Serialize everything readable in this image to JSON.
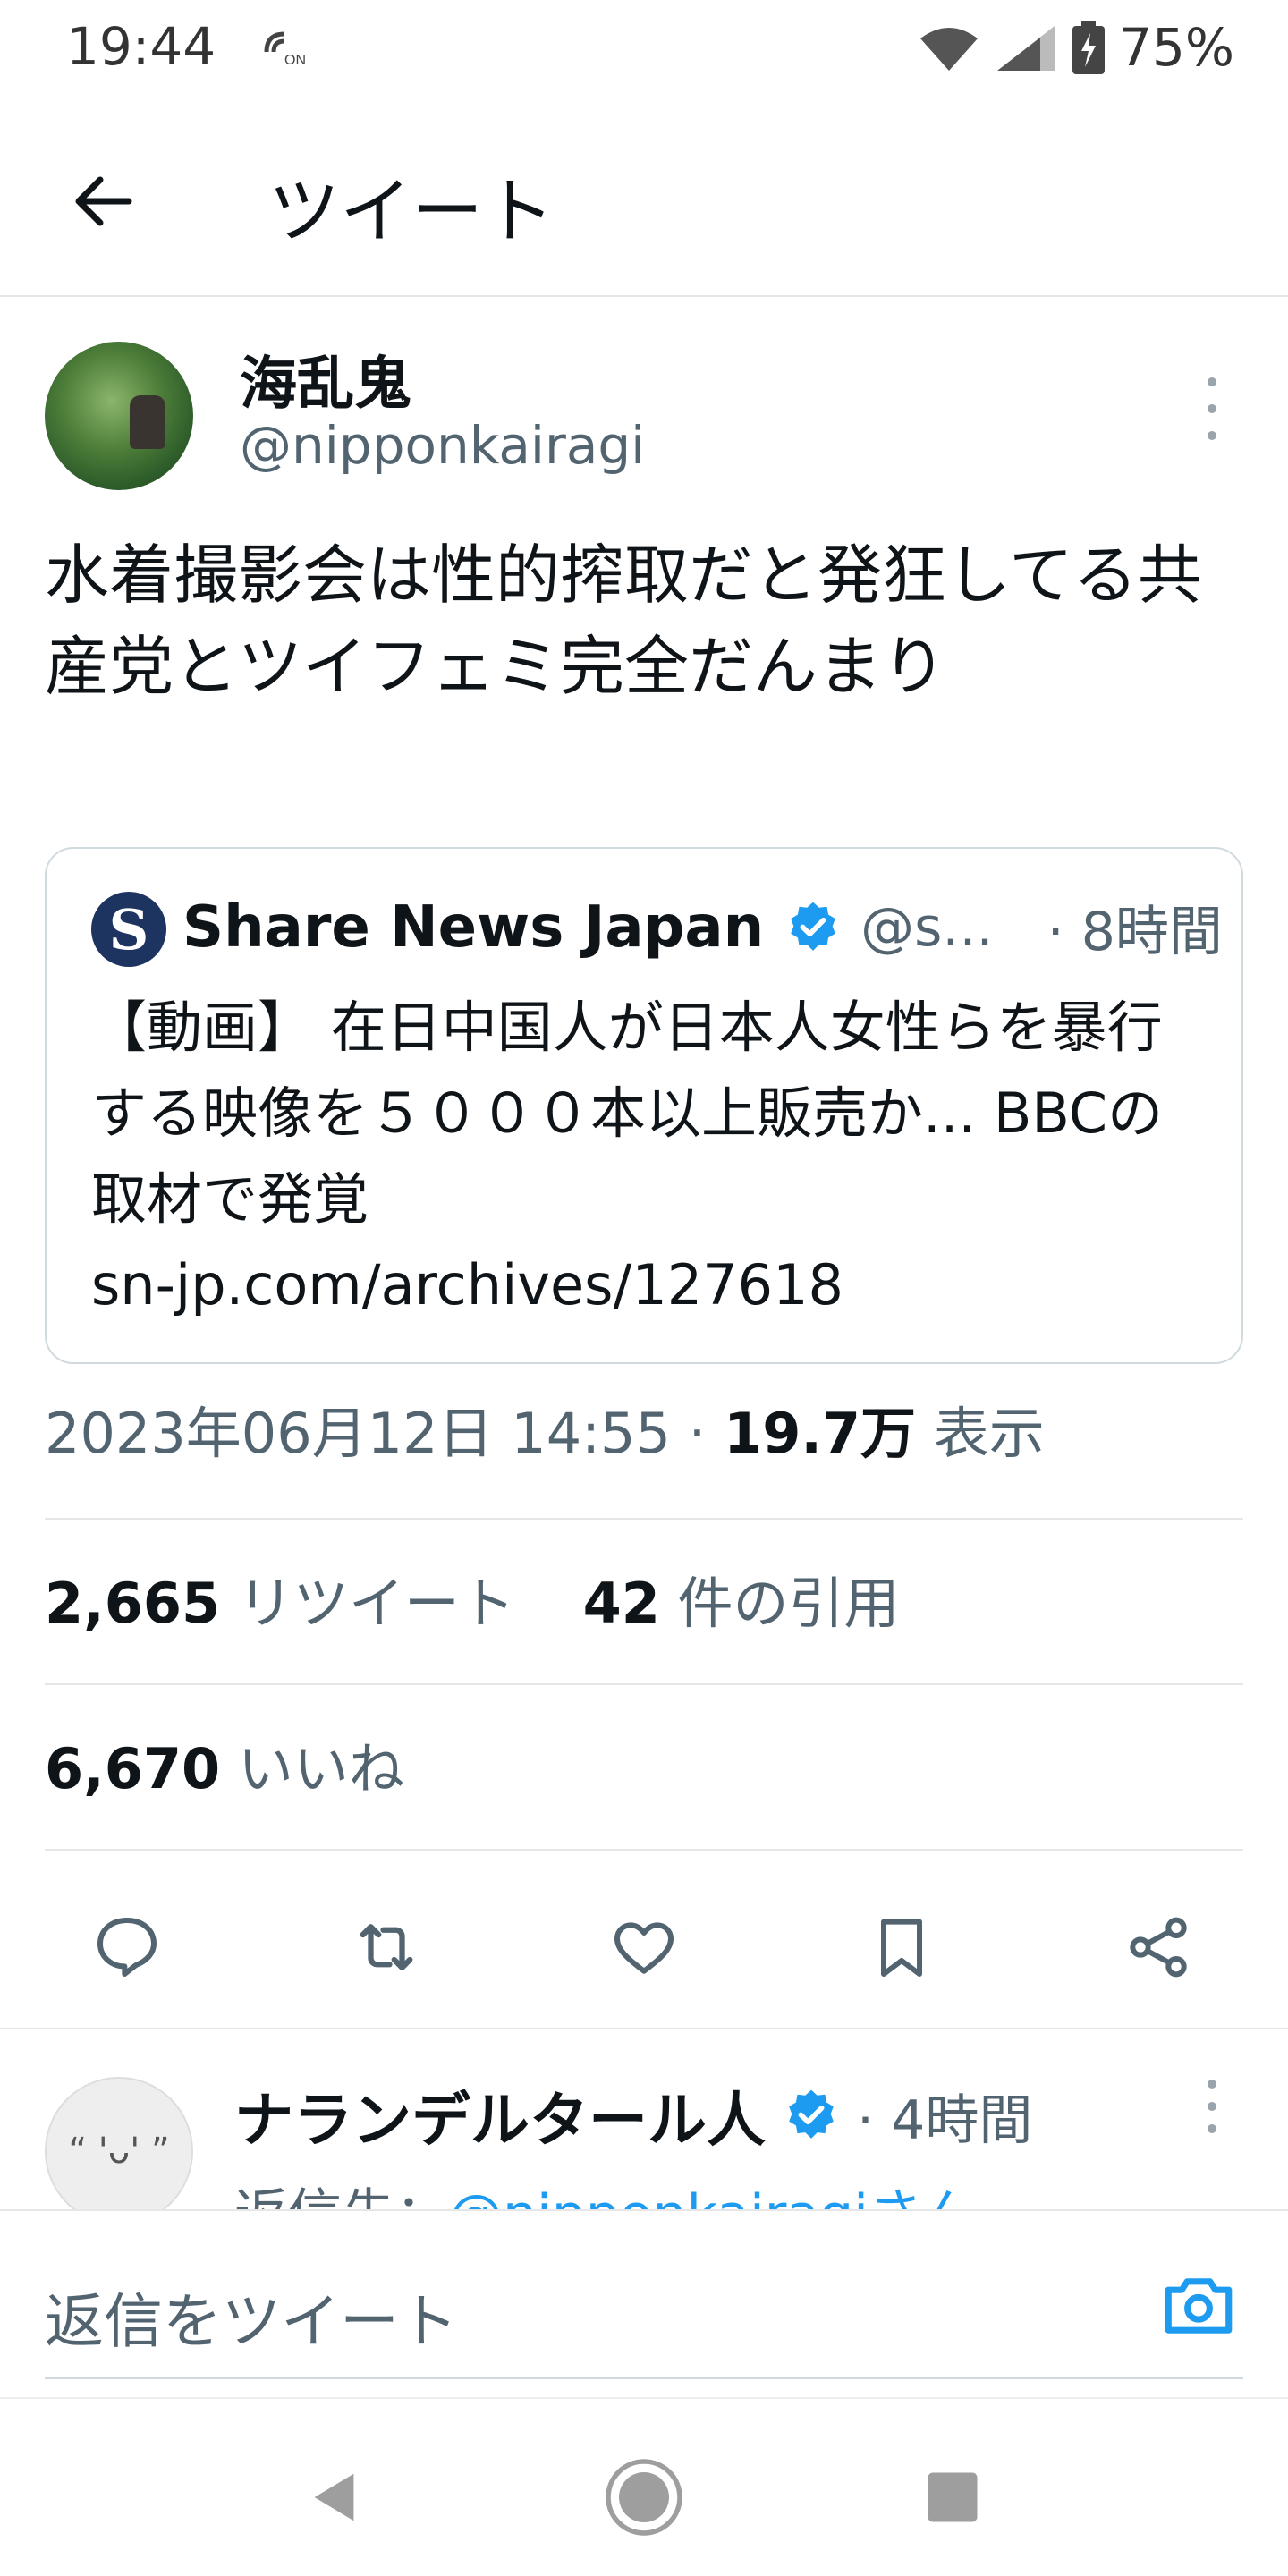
{
  "status_bar": {
    "time": "19:44",
    "nfc_icon": "nfc-on-icon",
    "battery_percent": "75%"
  },
  "header": {
    "title": "ツイート"
  },
  "tweet": {
    "display_name": "海乱鬼",
    "handle": "@nipponkairagi",
    "text": "水着撮影会は性的搾取だと発狂してる共産党とツイフェミ完全だんまり",
    "quote": {
      "logo_letter": "S",
      "name": "Share News Japan",
      "handle": "@s...",
      "time": "· 8時間",
      "body_line1": "【動画】 在日中国人が日本人女性らを暴行する映像を５０００本以上販売か... BBCの取材で発覚",
      "link": "sn-jp.com/archives/127618"
    },
    "timestamp": "2023年06月12日 14:55 · ",
    "views_count": "19.7万",
    "views_label": " 表示",
    "retweets_count": "2,665",
    "retweets_label": " リツイート",
    "quotes_count": "42",
    "quotes_label": " 件の引用",
    "likes_count": "6,670",
    "likes_label": " いいね"
  },
  "reply": {
    "avatar_glyph": "“ 'ᴗ' ”",
    "display_name": "ナランデルタール人",
    "time": "· 4時間",
    "reply_to_prefix": "返信先：",
    "reply_to_link": "@nipponkairagiさん"
  },
  "compose": {
    "placeholder": "返信をツイート"
  },
  "colors": {
    "accent": "#1d9bf0",
    "secondary_text": "#536471",
    "primary_text": "#0f1419",
    "border": "#cfd9de"
  }
}
